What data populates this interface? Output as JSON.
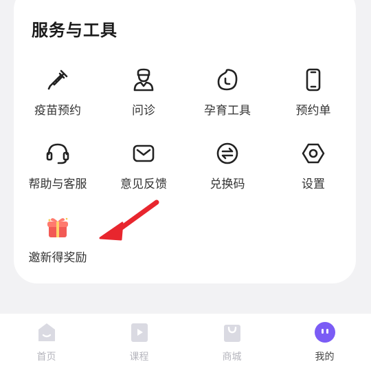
{
  "section": {
    "title": "服务与工具"
  },
  "tools": [
    {
      "label": "疫苗预约",
      "icon": "syringe-icon"
    },
    {
      "label": "问诊",
      "icon": "doctor-icon"
    },
    {
      "label": "孕育工具",
      "icon": "pregnancy-tool-icon"
    },
    {
      "label": "预约单",
      "icon": "phone-icon"
    },
    {
      "label": "帮助与客服",
      "icon": "headset-icon"
    },
    {
      "label": "意见反馈",
      "icon": "mail-icon"
    },
    {
      "label": "兑换码",
      "icon": "exchange-icon"
    },
    {
      "label": "设置",
      "icon": "gear-icon"
    },
    {
      "label": "邀新得奖励",
      "icon": "gift-icon"
    }
  ],
  "tabbar": [
    {
      "label": "首页",
      "icon": "home-icon",
      "active": false
    },
    {
      "label": "课程",
      "icon": "course-icon",
      "active": false
    },
    {
      "label": "商城",
      "icon": "shop-icon",
      "active": false
    },
    {
      "label": "我的",
      "icon": "profile-icon",
      "active": true
    }
  ],
  "colors": {
    "accent": "#7b5cf5",
    "arrow": "#e8262e",
    "gift": "#f04a4a",
    "tab_inactive": "#dadae2"
  }
}
